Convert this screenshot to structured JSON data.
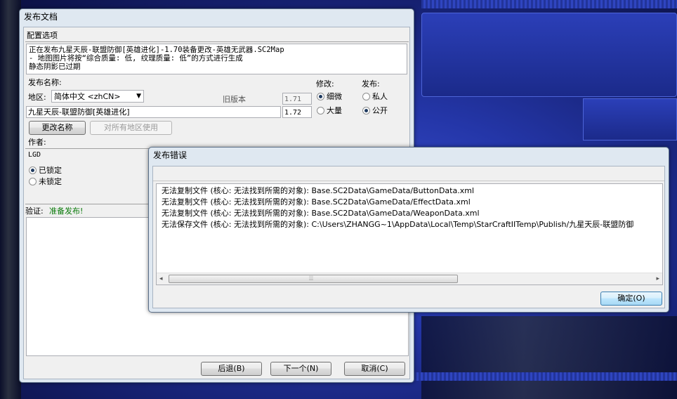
{
  "publish_dialog": {
    "title": "发布文档",
    "config_section_label": "配置选项",
    "info_lines": [
      "正在发布九星天辰-联盟防御[英雄进化]-1.70装备更改-英雄无武器.SC2Map",
      "- 地图图片将按“综合质量: 低, 纹理质量: 低”的方式进行生成",
      "静态阴影已过期"
    ],
    "publish_name_label": "发布名称:",
    "region_label": "地区:",
    "region_value": "简体中文 <zhCN>",
    "old_version_label": "旧版本",
    "old_version_value": "1.71",
    "map_name_value": "九星天辰-联盟防御[英雄进化]",
    "new_version_value": "1.72",
    "rename_button": "更改名称",
    "use_all_regions_button": "对所有地区使用",
    "modify_label": "修改:",
    "modify_options": [
      "细微",
      "大量"
    ],
    "publish_label": "发布:",
    "publish_options": [
      "私人",
      "公开"
    ],
    "author_label": "作者:",
    "author_value": "LGD",
    "lock_options": [
      "已锁定",
      "未锁定"
    ],
    "validation_label": "验证:",
    "validation_status": "准备发布!",
    "back_button": "后退(B)",
    "next_button": "下一个(N)",
    "cancel_button": "取消(C)"
  },
  "error_dialog": {
    "title": "发布错误",
    "errors": [
      "无法复制文件 (核心: 无法找到所需的对象): Base.SC2Data\\GameData/ButtonData.xml",
      "无法复制文件 (核心: 无法找到所需的对象): Base.SC2Data\\GameData/EffectData.xml",
      "无法复制文件 (核心: 无法找到所需的对象): Base.SC2Data\\GameData/WeaponData.xml",
      "无法保存文件 (核心: 无法找到所需的对象): C:\\Users\\ZHANGG~1\\AppData\\Local\\Temp\\StarCraftIITemp\\Publish/九星天辰-联盟防御"
    ],
    "ok_button": "确定(O)"
  }
}
